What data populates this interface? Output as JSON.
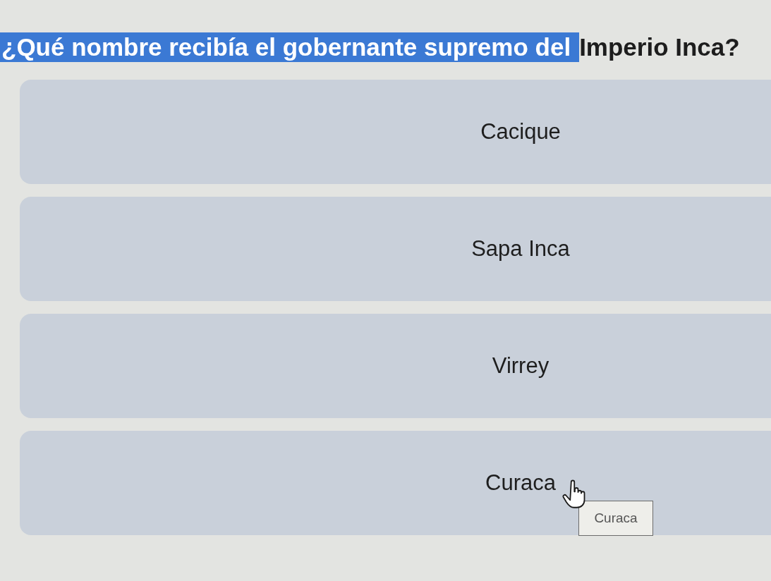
{
  "question": {
    "segments": [
      {
        "text": "¿Qué nombre recibía el gobernante supremo del",
        "selected": true
      },
      {
        "text": "Imperio Inca?",
        "selected": false
      }
    ]
  },
  "options": [
    {
      "label": "Cacique"
    },
    {
      "label": "Sapa Inca"
    },
    {
      "label": "Virrey"
    },
    {
      "label": "Curaca"
    }
  ],
  "tooltip": {
    "text": "Curaca"
  }
}
